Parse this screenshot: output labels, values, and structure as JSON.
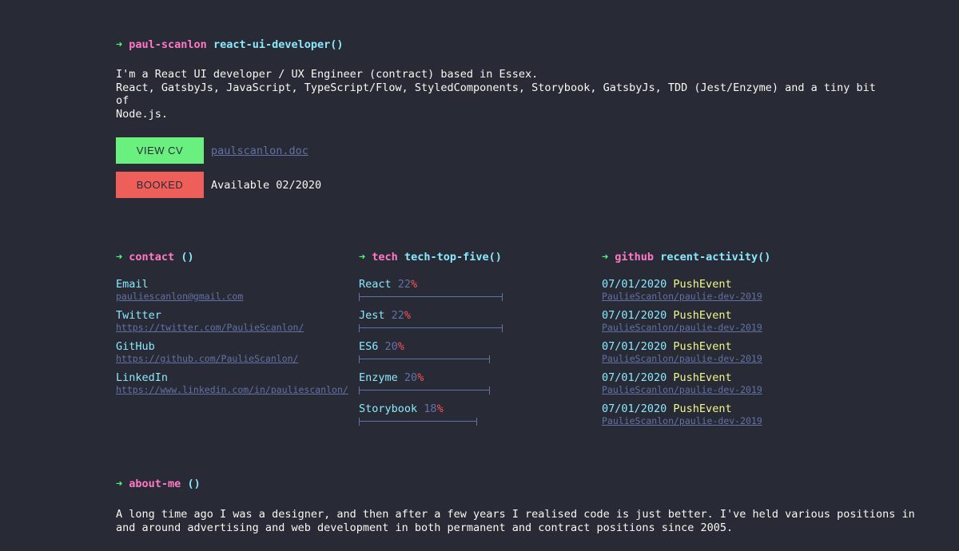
{
  "header": {
    "name": "paul-scanlon",
    "role": "react-ui-developer()"
  },
  "intro": {
    "text": "I'm a React UI developer / UX Engineer (contract) based in Essex.\nReact, GatsbyJs, JavaScript, TypeScript/Flow, StyledComponents, Storybook, GatsbyJs, TDD (Jest/Enzyme) and a tiny bit of\nNode.js."
  },
  "cv": {
    "button_label": "VIEW CV",
    "link_text": "paulscanlon.doc"
  },
  "booking": {
    "button_label": "BOOKED",
    "status": "Available 02/2020"
  },
  "contact": {
    "keyword": "contact",
    "fn": "()",
    "items": [
      {
        "label": "Email",
        "url": "pauliescanlon@gmail.com"
      },
      {
        "label": "Twitter",
        "url": "https://twitter.com/PaulieScanlon/"
      },
      {
        "label": "GitHub",
        "url": "https://github.com/PaulieScanlon/"
      },
      {
        "label": "LinkedIn",
        "url": "https://www.linkedin.com/in/pauliescanlon/"
      }
    ]
  },
  "tech": {
    "keyword": "tech",
    "fn": "tech-top-five()",
    "items": [
      {
        "name": "React",
        "value": 22,
        "pct_sign": "%"
      },
      {
        "name": "Jest",
        "value": 22,
        "pct_sign": "%"
      },
      {
        "name": "ES6",
        "value": 20,
        "pct_sign": "%"
      },
      {
        "name": "Enzyme",
        "value": 20,
        "pct_sign": "%"
      },
      {
        "name": "Storybook",
        "value": 18,
        "pct_sign": "%"
      }
    ]
  },
  "github": {
    "keyword": "github",
    "fn": "recent-activity()",
    "items": [
      {
        "date": "07/01/2020",
        "event": "PushEvent",
        "repo": "PaulieScanlon/paulie-dev-2019"
      },
      {
        "date": "07/01/2020",
        "event": "PushEvent",
        "repo": "PaulieScanlon/paulie-dev-2019"
      },
      {
        "date": "07/01/2020",
        "event": "PushEvent",
        "repo": "PaulieScanlon/paulie-dev-2019"
      },
      {
        "date": "07/01/2020",
        "event": "PushEvent",
        "repo": "PaulieScanlon/paulie-dev-2019"
      },
      {
        "date": "07/01/2020",
        "event": "PushEvent",
        "repo": "PaulieScanlon/paulie-dev-2019"
      }
    ]
  },
  "about": {
    "keyword": "about-me",
    "fn": "()",
    "text": "A long time ago I was a designer, and then after a few years I realised code is just better. I've held various positions in\nand around advertising and web development in both permanent and contract positions since 2005."
  },
  "arrow_glyph": "➜",
  "colors": {
    "background": "#282a36",
    "keyword": "#ff79c6",
    "function": "#8be9fd",
    "arrow": "#50fa7b",
    "cv_button": "#69f07e",
    "booked_button": "#ef5f5a",
    "link": "#6272a4",
    "event": "#f1fa8c"
  }
}
